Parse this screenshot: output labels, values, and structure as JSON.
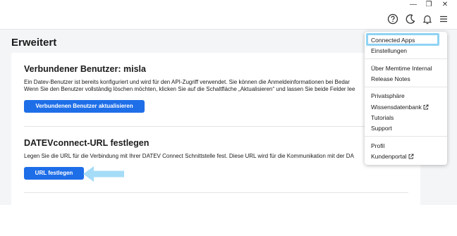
{
  "titlebar": {
    "minimize": "—",
    "restore": "❐",
    "close": "✕"
  },
  "toolbar": {
    "help_icon": "help-circle-icon",
    "theme_icon": "moon-icon",
    "bell_icon": "bell-icon",
    "menu_icon": "hamburger-menu-icon"
  },
  "page": {
    "title": "Erweitert"
  },
  "sections": [
    {
      "title": "Verbundener Benutzer: misla",
      "lines": [
        "Ein Datev-Benutzer ist bereits konfiguriert und wird für den API-Zugriff verwendet. Sie können die Anmeldeinformationen bei Bedar",
        "Wenn Sie den Benutzer vollständig löschen möchten, klicken Sie auf die Schaltfläche „Aktualisieren“ und lassen Sie beide Felder lee"
      ],
      "button": "Verbundenen Benutzer aktualisieren"
    },
    {
      "title": "DATEVconnect-URL festlegen",
      "lines": [
        "Legen Sie die URL für die Verbindung mit Ihrer DATEV Connect Schnittstelle fest. Diese URL wird für die Kommunikation mit der DA"
      ],
      "button": "URL festlegen"
    }
  ],
  "menu": {
    "items": [
      {
        "label": "Connected Apps",
        "highlighted": true
      },
      {
        "label": "Einstellungen"
      },
      {
        "label": "Über Memtime Internal"
      },
      {
        "label": "Release Notes"
      },
      {
        "label": "Privatsphäre"
      },
      {
        "label": "Wissensdatenbank",
        "external": true
      },
      {
        "label": "Tutorials"
      },
      {
        "label": "Support"
      },
      {
        "label": "Profil"
      },
      {
        "label": "Kundenportal",
        "external": true
      }
    ]
  },
  "colors": {
    "accent": "#1e6ee8",
    "highlight": "#8fd3f4",
    "arrow": "#a5dcf7",
    "background": "#f4f5f7"
  }
}
